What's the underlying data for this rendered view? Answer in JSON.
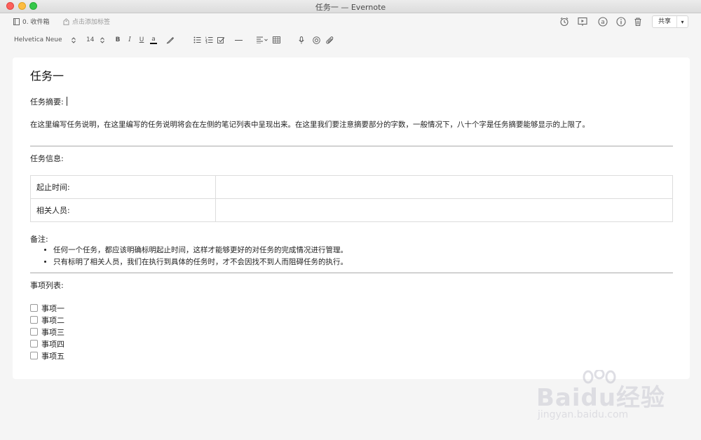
{
  "window": {
    "title": "任务一 — Evernote"
  },
  "toolbar": {
    "notebook": "0. 收件箱",
    "tags_placeholder": "点击添加标签",
    "share_label": "共享"
  },
  "format_bar": {
    "font_family": "Helvetica Neue",
    "font_size": "14",
    "bold": "B",
    "italic": "I",
    "underline": "U",
    "text_color": "a"
  },
  "note": {
    "title": "任务一",
    "summary_label": "任务摘要:",
    "summary_text": "在这里编写任务说明，在这里编写的任务说明将会在左侧的笔记列表中呈现出来。在这里我们要注意摘要部分的字数，一般情况下，八十个字是任务摘要能够显示的上限了。",
    "info_label": "任务信息:",
    "info_rows": [
      {
        "key": "起止时间:",
        "value": ""
      },
      {
        "key": "相关人员:",
        "value": ""
      }
    ],
    "notes_label": "备注:",
    "notes_items": [
      "任何一个任务，都应该明确标明起止时间，这样才能够更好的对任务的完成情况进行管理。",
      "只有标明了相关人员，我们在执行到具体的任务时，才不会因找不到人而阻碍任务的执行。"
    ],
    "todo_label": "事项列表:",
    "todo_items": [
      "事项一",
      "事项二",
      "事项三",
      "事项四",
      "事项五"
    ]
  },
  "watermark": {
    "brand": "Baidu经验",
    "url": "jingyan.baidu.com"
  },
  "icons": {
    "reminder": "alarm-clock-icon",
    "present": "presentation-icon",
    "mention": "at-sign-icon",
    "info": "info-icon",
    "trash": "trash-icon"
  }
}
